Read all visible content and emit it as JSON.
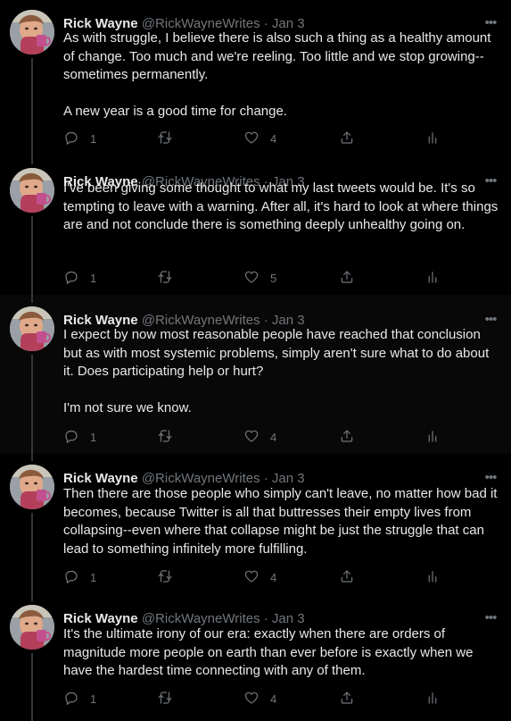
{
  "tweets": [
    {
      "name": "Rick Wayne",
      "handle": "@RickWayneWrites",
      "sep": "·",
      "date": "Jan 3",
      "more_icon": "more-icon",
      "text": "As with struggle, I believe there is also such a thing as a healthy amount of change. Too much and we're reeling. Too little and we stop growing--sometimes permanently.\n\nA new year is a good time for change.",
      "replies": "1",
      "retweets": "",
      "likes": "4"
    },
    {
      "name": "Rick Wayne",
      "handle": "@RickWayneWrites",
      "sep": "·",
      "date": "Jan 3",
      "more_icon": "more-icon",
      "text": "I've been giving some thought to what my last tweets would be. It's so tempting to leave with a warning. After all, it's hard to look at where things are and not conclude there is something deeply unhealthy going on.",
      "replies": "1",
      "retweets": "",
      "likes": "5"
    },
    {
      "name": "Rick Wayne",
      "handle": "@RickWayneWrites",
      "sep": "·",
      "date": "Jan 3",
      "more_icon": "more-icon",
      "text": "I expect by now most reasonable people have reached that conclusion but as with most systemic problems, simply aren't sure what to do about it. Does participating help or hurt?\n\nI'm not sure we know.",
      "replies": "1",
      "retweets": "",
      "likes": "4"
    },
    {
      "name": "Rick Wayne",
      "handle": "@RickWayneWrites",
      "sep": "·",
      "date": "Jan 3",
      "more_icon": "more-icon",
      "text": "Then there are those people who simply can't leave, no matter how bad it becomes, because Twitter is all that buttresses their empty lives from collapsing--even where that collapse might be just the struggle that can lead to something infinitely more fulfilling.",
      "replies": "1",
      "retweets": "",
      "likes": "4"
    },
    {
      "name": "Rick Wayne",
      "handle": "@RickWayneWrites",
      "sep": "·",
      "date": "Jan 3",
      "more_icon": "more-icon",
      "text": "It's the ultimate irony of our era: exactly when there are orders of magnitude more people on earth than ever before is exactly when we have the hardest time connecting with any of them.",
      "replies": "1",
      "retweets": "",
      "likes": "4"
    }
  ],
  "icons": {
    "reply": "reply-icon",
    "retweet": "retweet-icon",
    "like": "like-icon",
    "share": "share-icon",
    "analytics": "analytics-icon"
  },
  "colors": {
    "background": "#000000",
    "text": "#e7e9ea",
    "secondary": "#71767b",
    "thread_line": "#333639"
  }
}
